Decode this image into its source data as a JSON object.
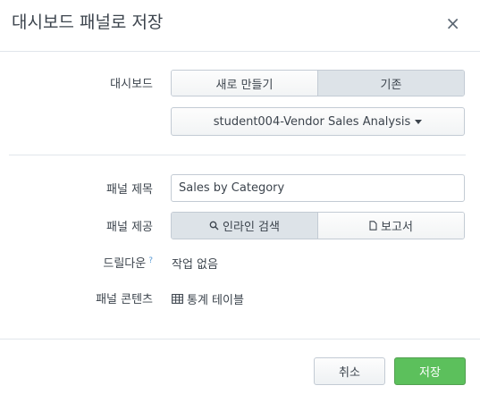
{
  "dialog": {
    "title": "대시보드 패널로 저장",
    "close_glyph": "×"
  },
  "dashboard": {
    "label": "대시보드",
    "options": [
      "새로 만들기",
      "기존"
    ],
    "selected": "기존",
    "dropdown_value": "student004-Vendor Sales Analysis"
  },
  "panel_title": {
    "label": "패널 제목",
    "value": "Sales by Category"
  },
  "panel_source": {
    "label": "패널 제공",
    "options": [
      {
        "label": "인라인 검색",
        "icon": "search-icon"
      },
      {
        "label": "보고서",
        "icon": "document-icon"
      }
    ],
    "selected": "인라인 검색"
  },
  "drilldown": {
    "label": "드릴다운",
    "help": "?",
    "value": "작업 없음"
  },
  "panel_content": {
    "label": "패널 콘텐츠",
    "icon": "table-icon",
    "value": "통계 테이블"
  },
  "footer": {
    "cancel": "취소",
    "save": "저장"
  },
  "colors": {
    "save_button": "#5cc05c",
    "active_segment": "#dde3e8",
    "border": "#c3cbd4"
  }
}
